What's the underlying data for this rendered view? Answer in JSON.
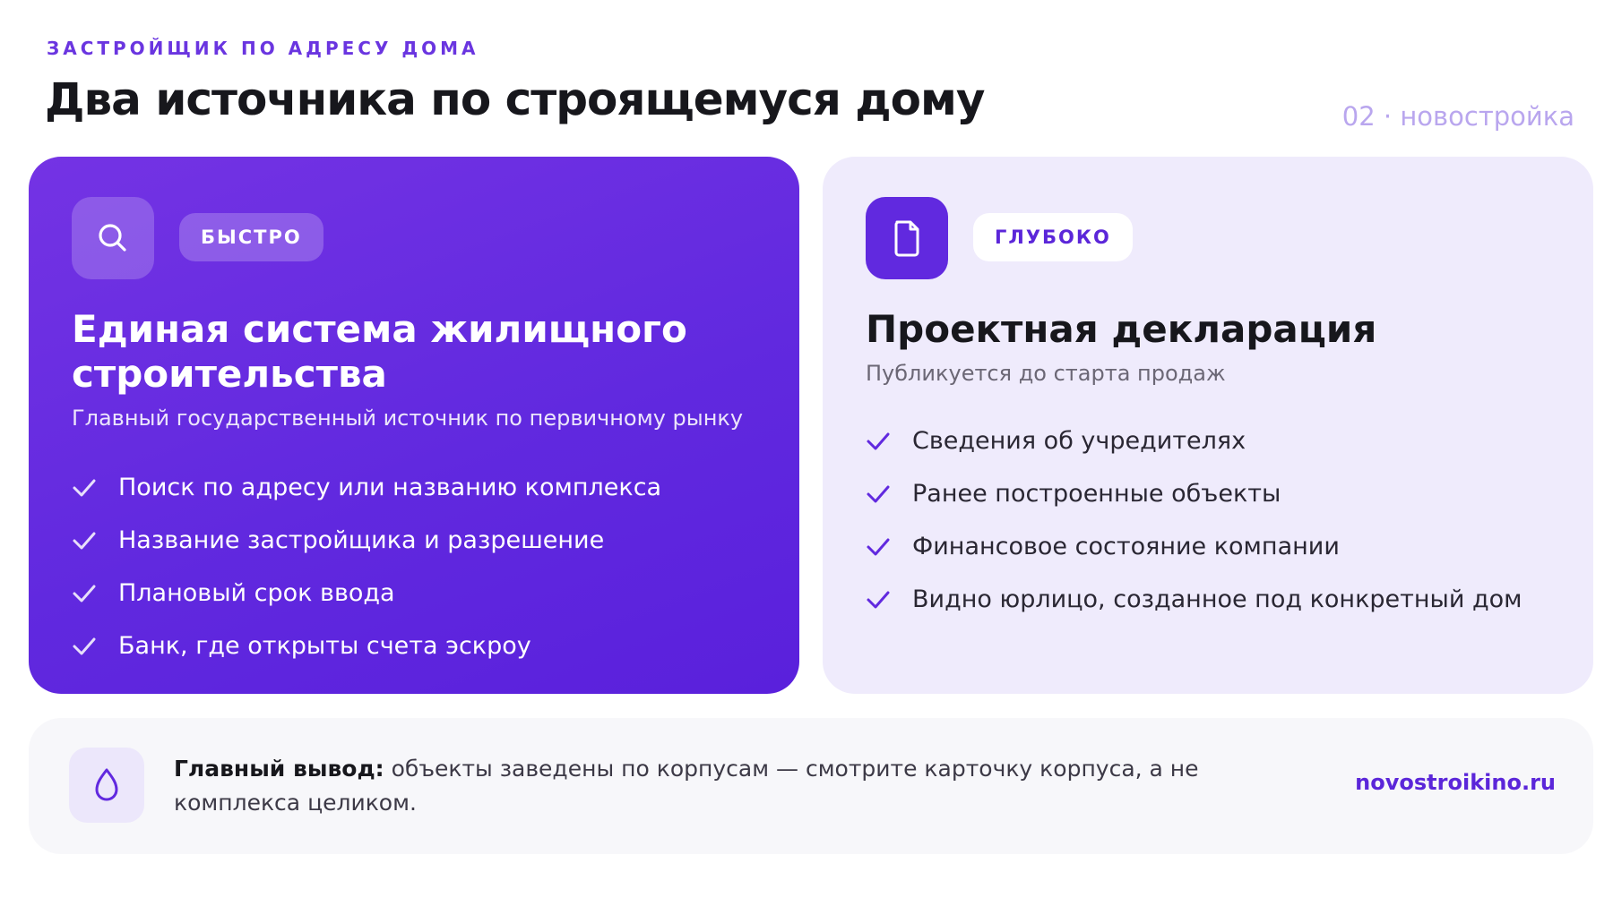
{
  "header": {
    "eyebrow": "ЗАСТРОЙЩИК ПО АДРЕСУ ДОМА",
    "title": "Два источника по строящемуся дому",
    "meta": "02 · новостройка"
  },
  "cards": [
    {
      "icon": "search-icon",
      "badge": "БЫСТРО",
      "title": "Единая система жилищного строительства",
      "subtitle": "Главный государственный источник по первичному рынку",
      "items": [
        "Поиск по адресу или названию комплекса",
        "Название застройщика и разрешение",
        "Плановый срок ввода",
        "Банк, где открыты счета эскроу"
      ]
    },
    {
      "icon": "document-icon",
      "badge": "ГЛУБОКО",
      "title": "Проектная декларация",
      "subtitle": "Публикуется до старта продаж",
      "items": [
        "Сведения об учредителях",
        "Ранее построенные объекты",
        "Финансовое состояние компании",
        "Видно юрлицо, созданное под конкретный дом"
      ]
    }
  ],
  "footer": {
    "icon": "drop-icon",
    "lead": "Главный вывод:",
    "text": " объекты заведены по корпусам — смотрите карточку корпуса, а не комплекса целиком.",
    "site": "novostroikino.ru"
  },
  "colors": {
    "accent": "#6129df",
    "accent_light": "#efebfc",
    "meta": "#b9a6ee",
    "text": "#17171c"
  }
}
